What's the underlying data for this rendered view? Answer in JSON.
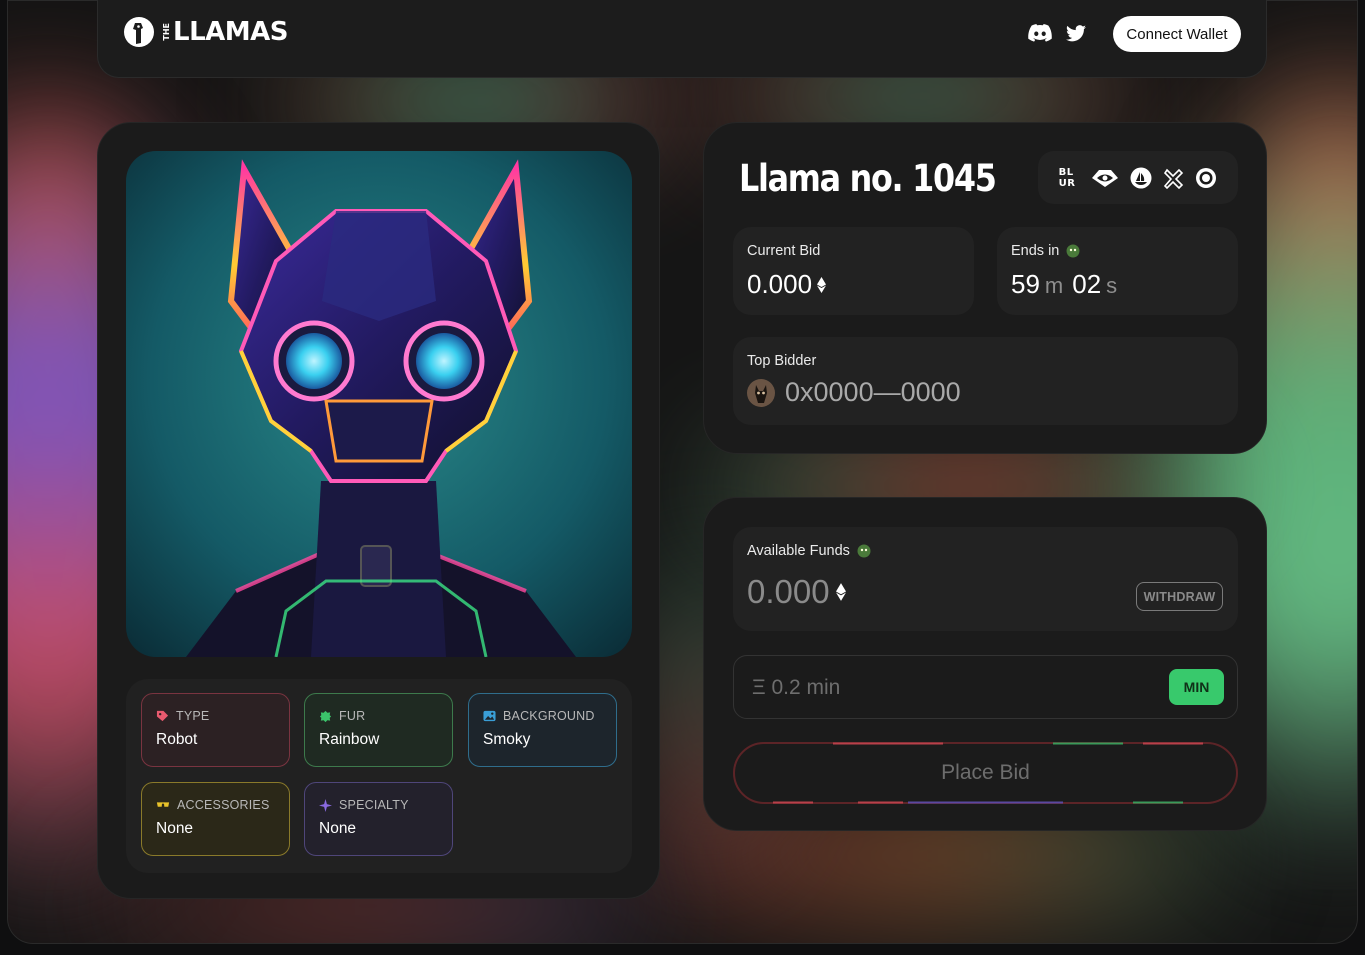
{
  "header": {
    "logo_text": "LLAMAS",
    "logo_prefix": "THE",
    "social_icons": [
      "discord-icon",
      "twitter-icon"
    ],
    "connect_label": "Connect Wallet"
  },
  "nft": {
    "traits": [
      {
        "label": "TYPE",
        "value": "Robot",
        "icon": "tag-icon",
        "color": "#e85a6e"
      },
      {
        "label": "FUR",
        "value": "Rainbow",
        "icon": "fur-icon",
        "color": "#3bc46b"
      },
      {
        "label": "BACKGROUND",
        "value": "Smoky",
        "icon": "image-icon",
        "color": "#3a9ed6"
      },
      {
        "label": "ACCESSORIES",
        "value": "None",
        "icon": "glasses-icon",
        "color": "#e8c22a"
      },
      {
        "label": "SPECIALTY",
        "value": "None",
        "icon": "sparkle-icon",
        "color": "#8a6ae0"
      }
    ]
  },
  "auction": {
    "title": "Llama no. 1045",
    "marketplaces": [
      "blur-icon",
      "looksrare-icon",
      "opensea-icon",
      "x2y2-icon",
      "rarible-icon"
    ],
    "marketplace_blur_text": "BLUR",
    "current_bid_label": "Current Bid",
    "current_bid_value": "0.000",
    "ends_label": "Ends in",
    "ends_minutes": "59",
    "ends_minutes_unit": "m",
    "ends_seconds": "02",
    "ends_seconds_unit": "s",
    "top_bidder_label": "Top Bidder",
    "top_bidder_address": "0x0000—0000"
  },
  "wallet": {
    "available_label": "Available Funds",
    "available_value": "0.000",
    "withdraw_label": "WITHDRAW",
    "bid_placeholder": "Ξ 0.2 min",
    "min_label": "MIN",
    "place_bid_label": "Place Bid"
  },
  "colors": {
    "accent_green": "#38c96c",
    "card_bg": "#1b1b1b",
    "panel_bg": "#222222"
  }
}
